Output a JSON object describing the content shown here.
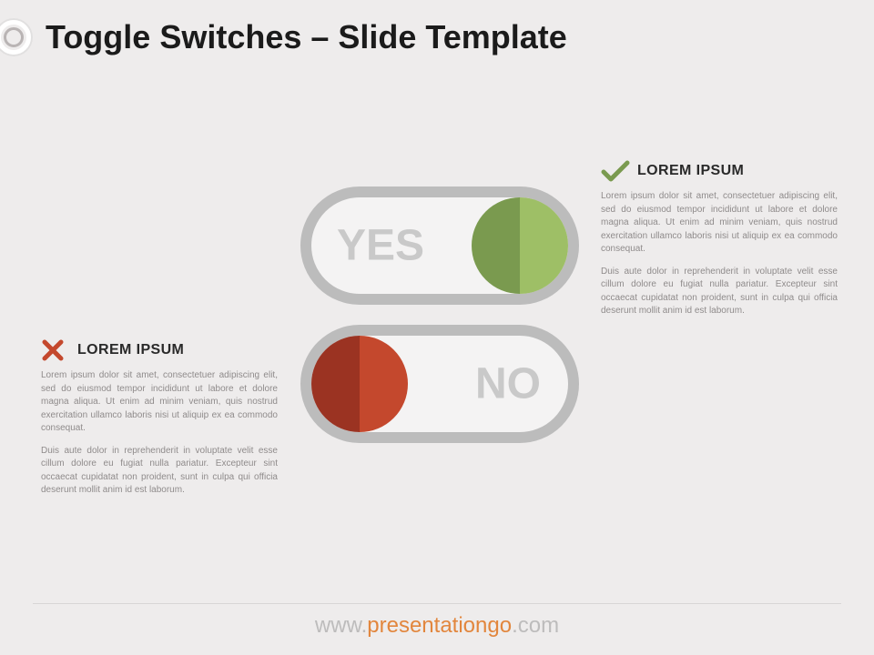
{
  "header": {
    "title": "Toggle Switches – Slide Template"
  },
  "toggles": {
    "yes_label": "YES",
    "no_label": "NO"
  },
  "callouts": {
    "yes": {
      "title": "LOREM IPSUM",
      "p1": "Lorem ipsum dolor sit amet, consectetuer adipiscing elit, sed do eiusmod tempor incididunt ut labore et dolore magna aliqua. Ut enim ad minim veniam, quis nostrud exercitation ullamco laboris nisi ut aliquip ex ea commodo consequat.",
      "p2": "Duis aute dolor in reprehenderit in voluptate velit esse cillum dolore eu fugiat nulla pariatur. Excepteur sint occaecat cupidatat non proident, sunt in culpa qui officia deserunt mollit anim id est laborum."
    },
    "no": {
      "title": "LOREM IPSUM",
      "p1": "Lorem ipsum dolor sit amet, consectetuer adipiscing elit, sed do eiusmod tempor incididunt ut labore et dolore magna aliqua. Ut enim ad minim veniam, quis nostrud exercitation ullamco laboris nisi ut aliquip ex ea commodo consequat.",
      "p2": "Duis aute dolor in reprehenderit in voluptate velit esse cillum dolore eu fugiat nulla pariatur. Excepteur sint occaecat cupidatat non proident, sunt in culpa qui officia deserunt mollit anim id est laborum."
    }
  },
  "footer": {
    "pre": "www.",
    "mid": "presentationgo",
    "suf": ".com"
  },
  "colors": {
    "green_dark": "#7a9a4f",
    "green_light": "#9ebf66",
    "red_dark": "#9b3322",
    "red_light": "#c4482d"
  }
}
